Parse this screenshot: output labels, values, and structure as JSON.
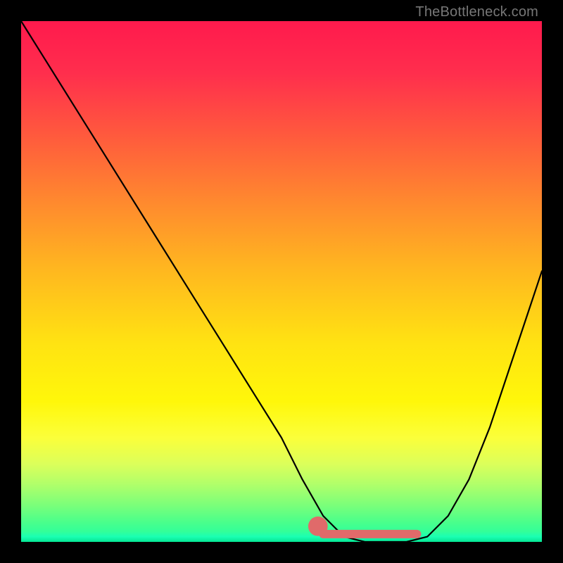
{
  "attribution": "TheBottleneck.com",
  "chart_data": {
    "type": "line",
    "title": "",
    "xlabel": "",
    "ylabel": "",
    "xlim": [
      0,
      100
    ],
    "ylim": [
      0,
      100
    ],
    "grid": false,
    "legend": false,
    "series": [
      {
        "name": "bottleneck-curve",
        "x": [
          0,
          5,
          10,
          15,
          20,
          25,
          30,
          35,
          40,
          45,
          50,
          54,
          58,
          62,
          66,
          70,
          74,
          78,
          82,
          86,
          90,
          94,
          98,
          100
        ],
        "values": [
          100,
          92,
          84,
          76,
          68,
          60,
          52,
          44,
          36,
          28,
          20,
          12,
          5,
          1,
          0,
          0,
          0,
          1,
          5,
          12,
          22,
          34,
          46,
          52
        ]
      }
    ],
    "markers": [
      {
        "name": "optimal-start-dot",
        "x": 57,
        "y": 3,
        "color": "#e06a6a",
        "r": 1.2
      },
      {
        "name": "optimal-range-bar",
        "x0": 58,
        "x1": 76,
        "y": 1.5,
        "color": "#e06a6a"
      }
    ],
    "colors": {
      "curve": "#000000",
      "marker": "#e06a6a",
      "gradient_top": "#ff1a4d",
      "gradient_mid": "#ffe312",
      "gradient_bottom": "#05e693"
    }
  }
}
